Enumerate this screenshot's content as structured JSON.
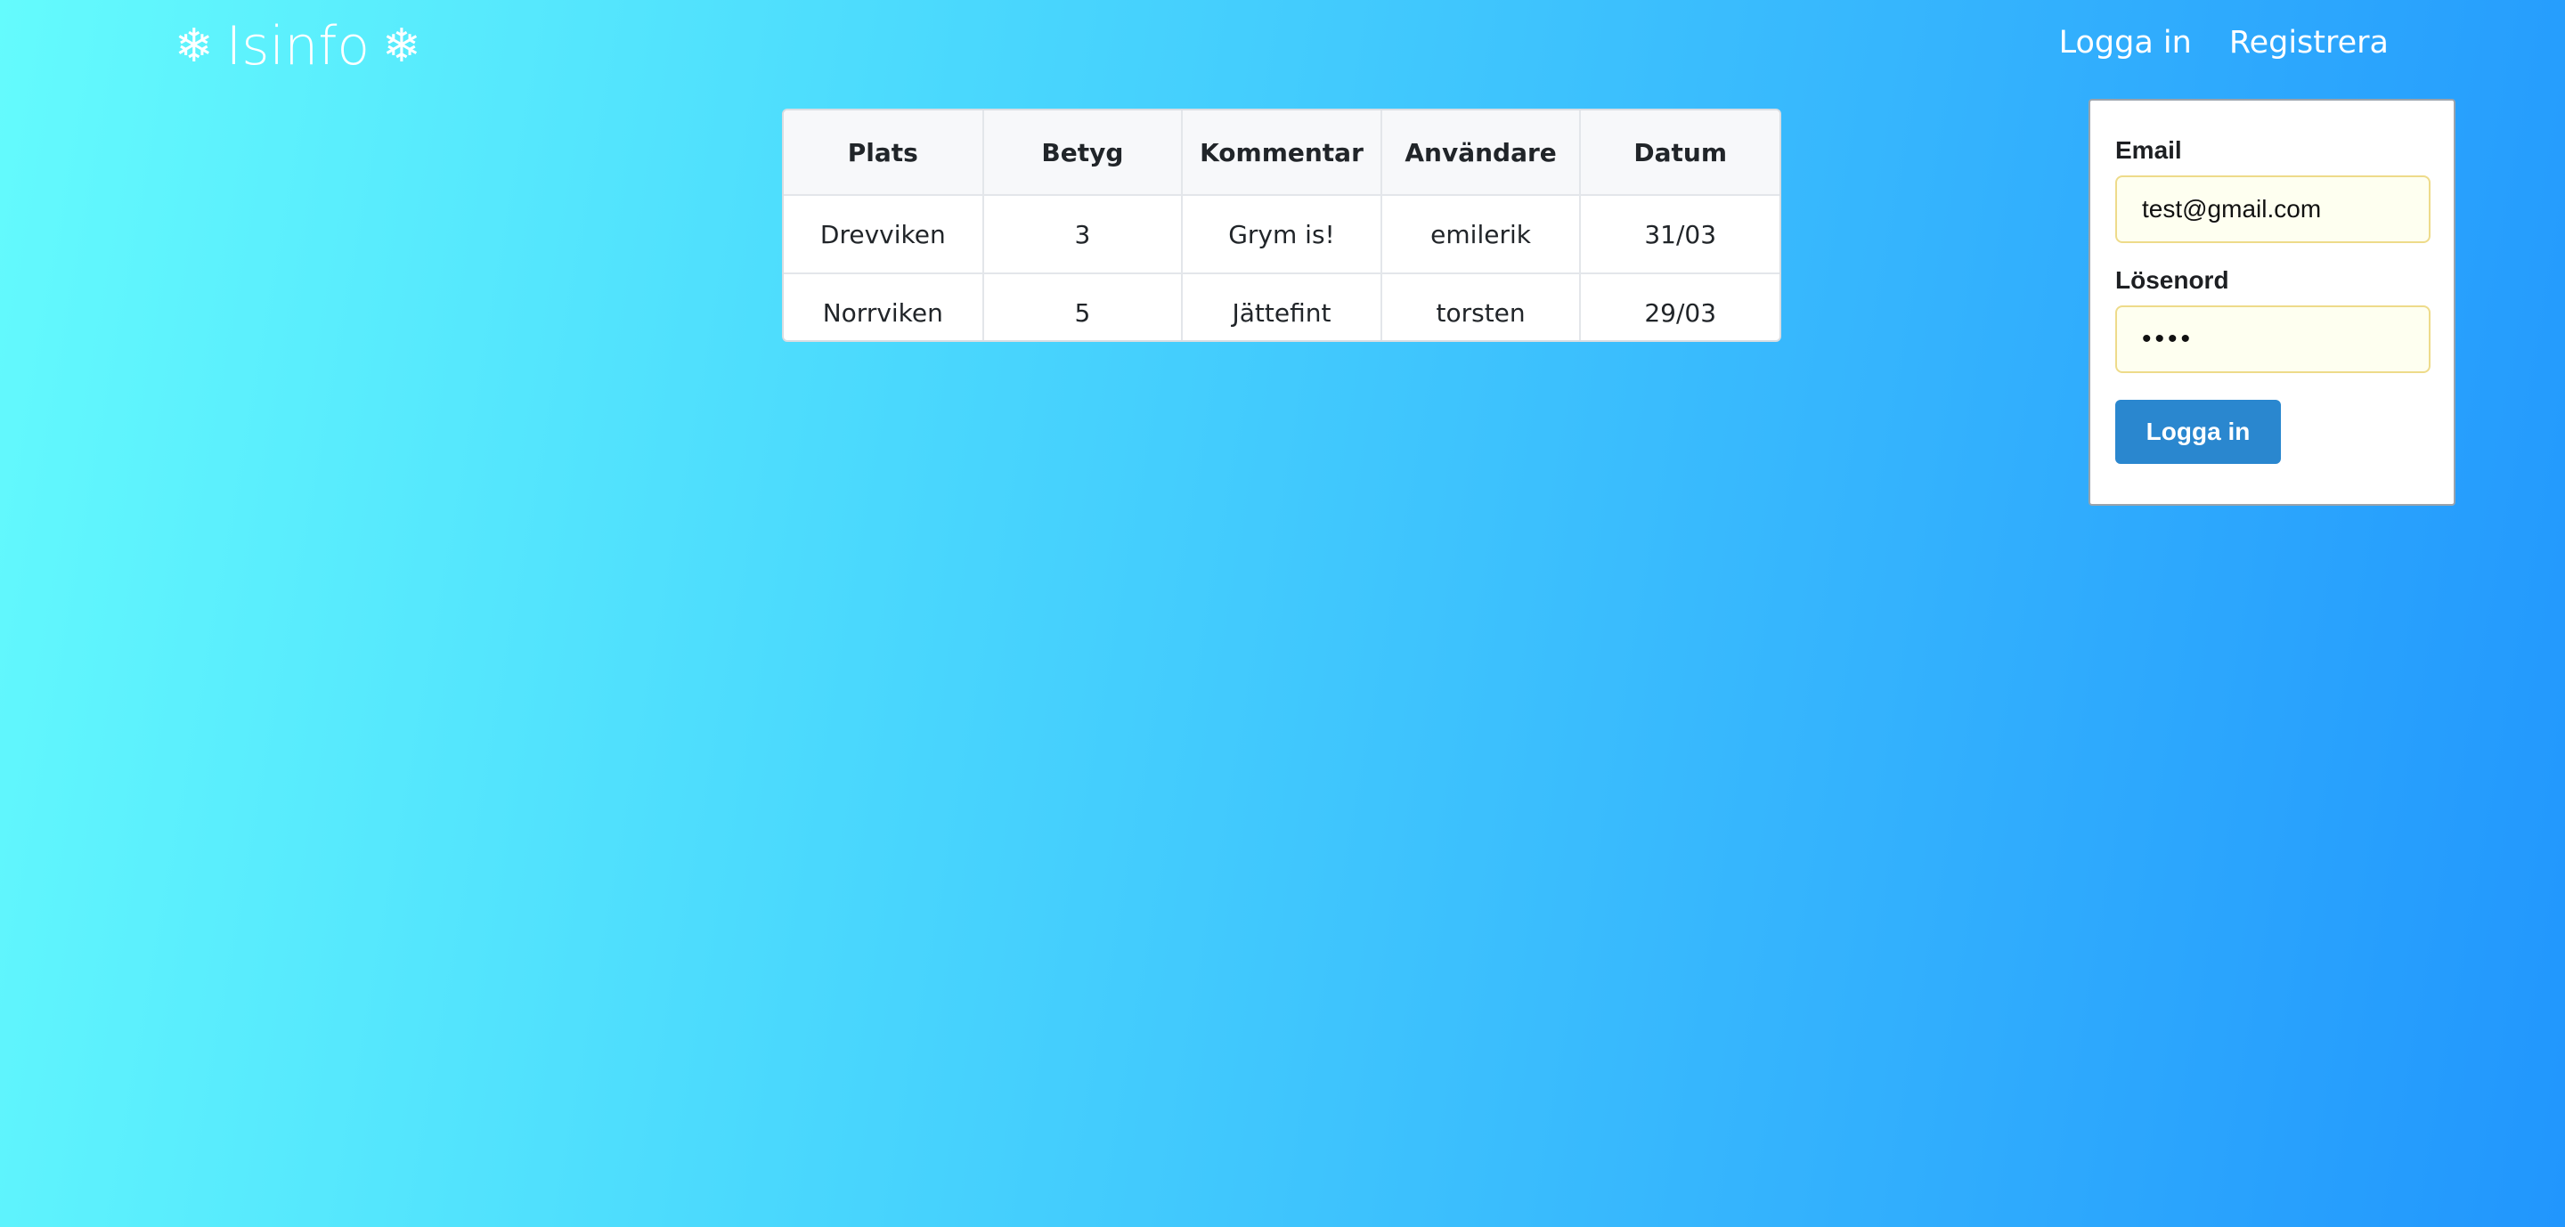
{
  "brand": {
    "left_icon": "❄",
    "title": "Isinfo",
    "right_icon": "❄",
    "icon_name": "snowflake-icon"
  },
  "nav": {
    "login": "Logga in",
    "register": "Registrera"
  },
  "table": {
    "headers": [
      "Plats",
      "Betyg",
      "Kommentar",
      "Användare",
      "Datum"
    ],
    "rows": [
      [
        "Drevviken",
        "3",
        "Grym is!",
        "emilerik",
        "31/03"
      ],
      [
        "Norrviken",
        "5",
        "Jättefint",
        "torsten",
        "29/03"
      ]
    ]
  },
  "login_form": {
    "email_label": "Email",
    "email_value": "test@gmail.com",
    "password_label": "Lösenord",
    "password_value": "••••",
    "submit_label": "Logga in"
  },
  "colors": {
    "gradient_start": "#64fbfd",
    "gradient_end": "#2196fd",
    "button": "#2a87cf",
    "autofill_bg": "#fefff0"
  }
}
